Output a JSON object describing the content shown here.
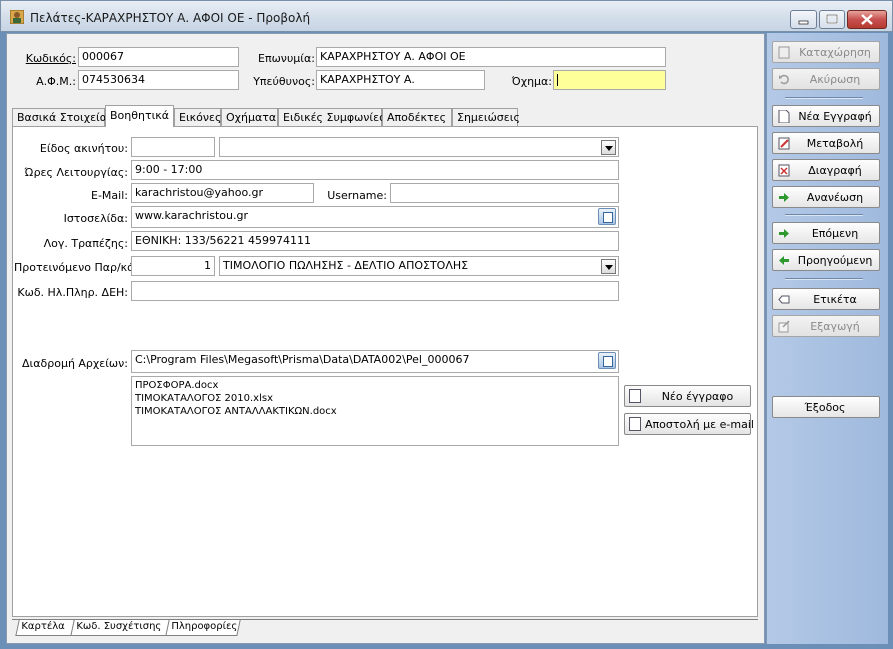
{
  "window": {
    "title": "Πελάτες-ΚΑΡΑΧΡΗΣΤΟΥ Α. ΑΦΟΙ ΟΕ  -  Προβολή"
  },
  "header": {
    "code_label": "Κωδικός:",
    "code_value": "000067",
    "afm_label": "Α.Φ.Μ.:",
    "afm_value": "074530634",
    "name_label": "Επωνυμία:",
    "name_value": "ΚΑΡΑΧΡΗΣΤΟΥ Α. ΑΦΟΙ ΟΕ",
    "responsible_label": "Υπεύθυνος:",
    "responsible_value": "ΚΑΡΑΧΡΗΣΤΟΥ Α.",
    "vehicle_label": "Όχημα:",
    "vehicle_value": ""
  },
  "tabs": [
    {
      "label": "Βασικά Στοιχεία"
    },
    {
      "label": "Βοηθητικά"
    },
    {
      "label": "Εικόνες"
    },
    {
      "label": "Οχήματα"
    },
    {
      "label": "Ειδικές Συμφωνίες"
    },
    {
      "label": "Αποδέκτες"
    },
    {
      "label": "Σημειώσεις"
    }
  ],
  "form": {
    "property_type_label": "Είδος ακινήτου:",
    "property_type_code": "",
    "property_type_value": "",
    "hours_label": "Ώρες Λειτουργίας:",
    "hours_value": "9:00 - 17:00",
    "email_label": "E-Mail:",
    "email_value": "karachristou@yahoo.gr",
    "username_label": "Username:",
    "username_value": "",
    "website_label": "Ιστοσελίδα:",
    "website_value": "www.karachristou.gr",
    "bank_label": "Λογ. Τραπέζης:",
    "bank_value": "ΕΘΝΙΚΗ: 133/56221 459974111",
    "doc_label": "Προτεινόμενο Παρ/κό:",
    "doc_number": "1",
    "doc_value": "ΤΙΜΟΛΟΓΙΟ ΠΩΛΗΣΗΣ - ΔΕΛΤΙΟ ΑΠΟΣΤΟΛΗΣ",
    "dei_label": "Κωδ. Ηλ.Πληρ. ΔΕΗ:",
    "dei_value": "",
    "path_label": "Διαδρομή Αρχείων:",
    "path_value": "C:\\Program Files\\Megasoft\\Prisma\\Data\\DATA002\\Pel_000067",
    "files": [
      "ΠΡΟΣΦΟΡΑ.docx",
      "ΤΙΜΟΚΑΤΑΛΟΓΟΣ 2010.xlsx",
      "ΤΙΜΟΚΑΤΑΛΟΓΟΣ ΑΝΤΑΛΛΑΚΤΙΚΩΝ.docx"
    ],
    "new_doc_button": "Νέο έγγραφο",
    "send_email_button": "Αποστολή με e-mail"
  },
  "bottom_tabs": [
    {
      "label": "Καρτέλα"
    },
    {
      "label": "Κωδ. Συσχέτισης"
    },
    {
      "label": "Πληροφορίες"
    }
  ],
  "actions": {
    "save": "Καταχώρηση",
    "cancel": "Ακύρωση",
    "new_record": "Νέα Εγγραφή",
    "modify": "Μεταβολή",
    "delete": "Διαγραφή",
    "refresh": "Ανανέωση",
    "next": "Επόμενη",
    "previous": "Προηγούμενη",
    "label": "Ετικέτα",
    "export": "Εξαγωγή",
    "exit": "Έξοδος"
  },
  "colors": {
    "vehicle_field_bg": "#ffff99",
    "side_panel": "#a9c1e2"
  }
}
